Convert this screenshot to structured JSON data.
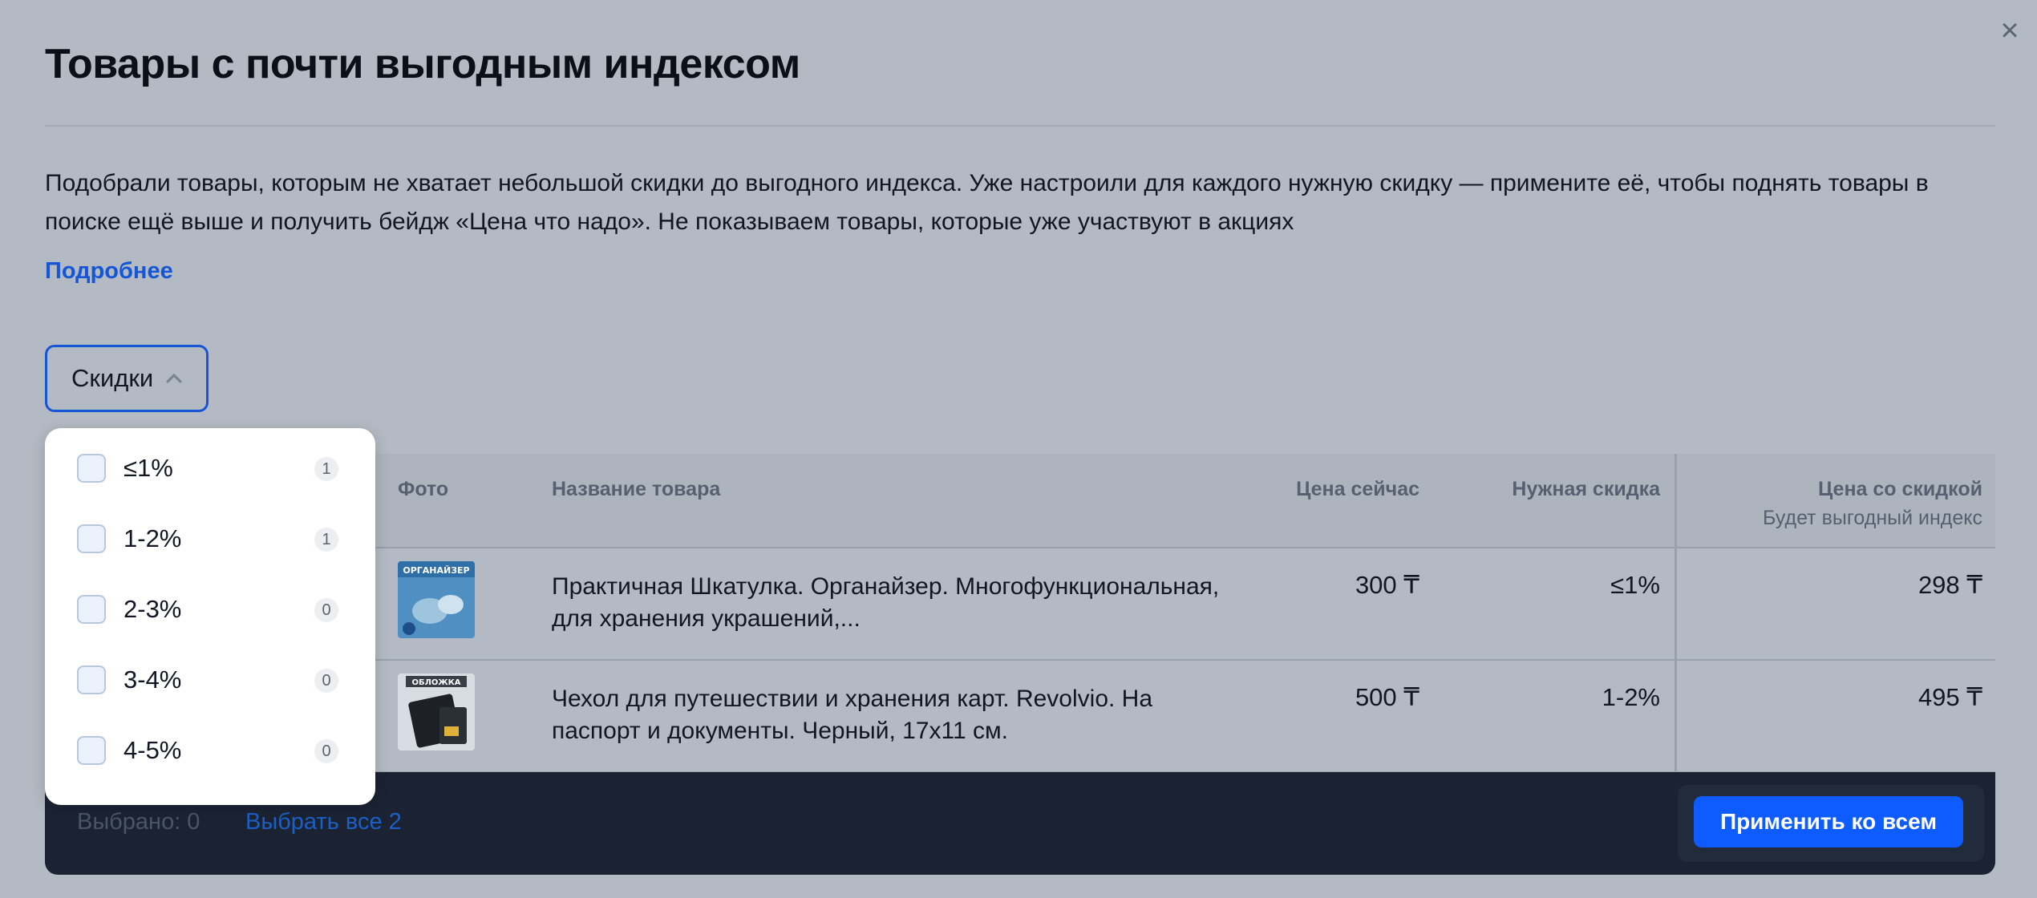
{
  "modal": {
    "title": "Товары с почти выгодным индексом",
    "description": "Подобрали товары, которым не хватает небольшой скидки до выгодного индекса. Уже настроили для каждого нужную скидку — примените её, чтобы поднять товары в поиске ещё выше и получить бейдж «Цена что надо». Не показываем товары, которые уже участвуют в акциях",
    "more_link": "Подробнее",
    "close_icon": "close-icon"
  },
  "filter": {
    "label": "Скидки",
    "icon": "chevron-up-icon",
    "options": [
      {
        "label": "≤1%",
        "count": "1",
        "checked": false
      },
      {
        "label": "1-2%",
        "count": "1",
        "checked": false
      },
      {
        "label": "2-3%",
        "count": "0",
        "checked": false
      },
      {
        "label": "3-4%",
        "count": "0",
        "checked": false
      },
      {
        "label": "4-5%",
        "count": "0",
        "checked": false
      }
    ]
  },
  "table": {
    "columns": {
      "photo": "Фото",
      "name": "Название товара",
      "price_now": "Цена сейчас",
      "needed_discount": "Нужная скидка",
      "discount_price": "Цена со скидкой",
      "discount_price_sub": "Будет выгодный индекс"
    },
    "rows": [
      {
        "name": "Практичная Шкатулка. Органайзер. Многофункциональная, для хранения украшений,...",
        "thumb_text": "ОРГАНАЙЗЕР",
        "price_now": "300 ₸",
        "needed_discount": "≤1%",
        "discount_price": "298 ₸"
      },
      {
        "name": "Чехол для путешествии и хранения карт. Revolvio. На паспорт и документы. Черный, 17х11 см.",
        "thumb_text": "ОБЛОЖКА",
        "price_now": "500 ₸",
        "needed_discount": "1-2%",
        "discount_price": "495 ₸"
      }
    ]
  },
  "bottom_bar": {
    "selected": "Выбрано: 0",
    "select_all": "Выбрать все 2",
    "apply": "Применить ко всем"
  },
  "colors": {
    "accent": "#1556d6",
    "apply_button": "#0e5cff",
    "bottom_bar": "#1b2333",
    "overlay_background": "#b4bac3"
  }
}
